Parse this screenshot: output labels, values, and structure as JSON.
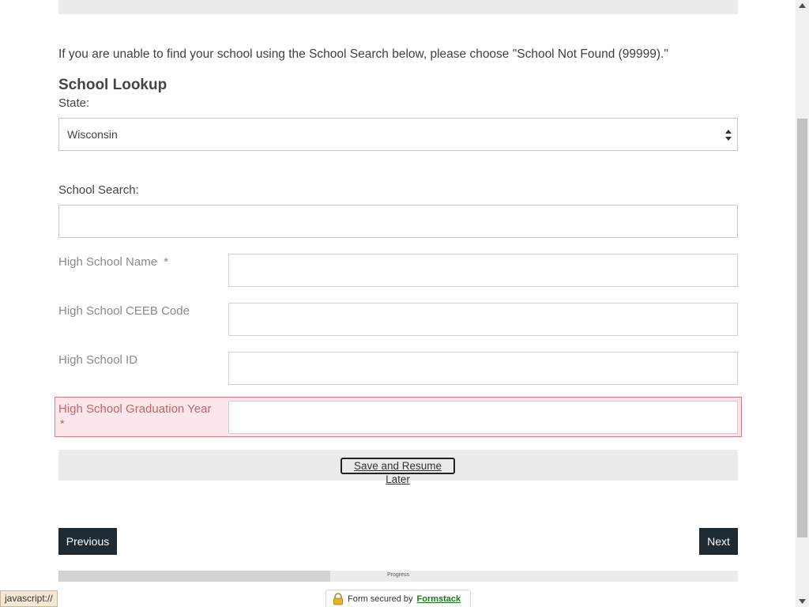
{
  "intro_text": "If you are unable to find your school using the School Search below, please choose \"School Not Found (99999).\"",
  "school_lookup": {
    "title": "School Lookup",
    "state_label": "State:",
    "state_value": "Wisconsin",
    "search_label": "School Search:",
    "search_value": ""
  },
  "fields": {
    "name_label": "High School Name",
    "name_required": "*",
    "ceeb_label": "High School CEEB Code",
    "id_label": "High School ID",
    "grad_year_label": "High School Graduation Year",
    "grad_year_required": "*"
  },
  "save_label": "Save and Resume Later",
  "nav": {
    "previous_label": "Previous",
    "next_label": "Next"
  },
  "progress": {
    "label": "Progress",
    "fraction": 0.4
  },
  "secured": {
    "text": "Form secured by",
    "link": "Formstack"
  },
  "status_bar_text": "javascript://",
  "colors": {
    "button_bg": "#1f2a33",
    "error_bg": "#fbe7ea",
    "error_border": "#d7797f",
    "link_green": "#1a7a1a"
  }
}
